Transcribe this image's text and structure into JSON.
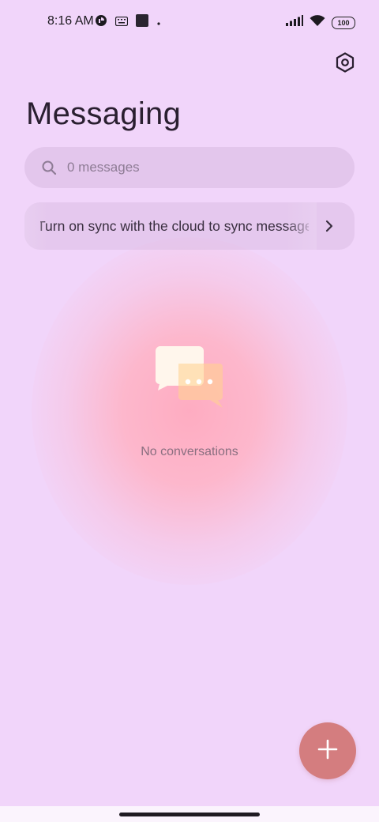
{
  "status_bar": {
    "time": "8:16 AM",
    "battery": "100",
    "icons_left": [
      "notification-app-icon",
      "keyboard-icon",
      "square-app-icon",
      "dot-icon"
    ],
    "icons_right": [
      "signal-icon",
      "wifi-icon",
      "battery-icon"
    ]
  },
  "header": {
    "title": "Messaging",
    "settings_icon": "settings-hexagon-icon"
  },
  "search": {
    "placeholder": "0 messages"
  },
  "sync_banner": {
    "text": "Turn on sync with the cloud to sync messages"
  },
  "empty_state": {
    "label": "No conversations",
    "icon": "chat-bubbles-icon"
  },
  "fab": {
    "icon": "plus-icon",
    "color": "#d47d7f"
  },
  "colors": {
    "background": "#f1d5fa",
    "glow": "#ffb4c4",
    "fab": "#d47d7f"
  }
}
